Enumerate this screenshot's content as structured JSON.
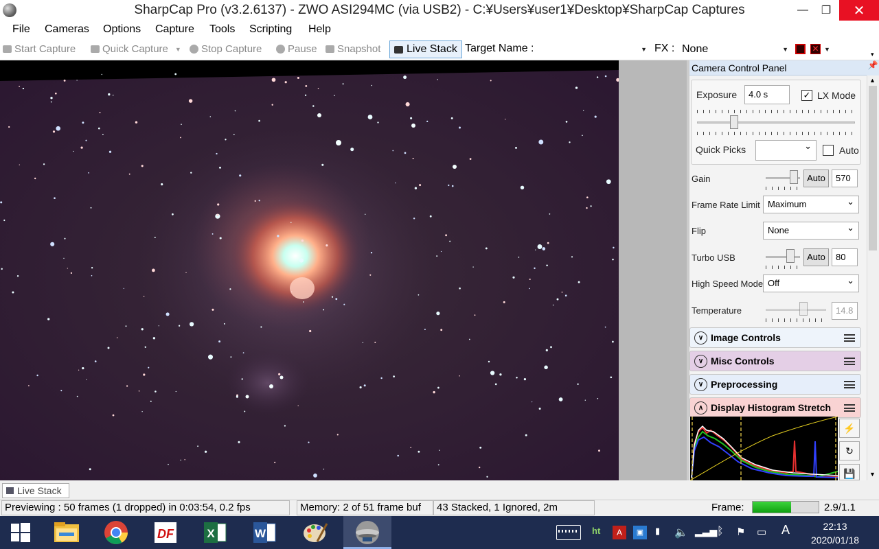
{
  "window": {
    "title": "SharpCap Pro (v3.2.6137) - ZWO ASI294MC (via USB2) - C:¥Users¥user1¥Desktop¥SharpCap Captures",
    "minimize": "—",
    "maximize": "❐",
    "close": "✕"
  },
  "menu": [
    "File",
    "Cameras",
    "Options",
    "Capture",
    "Tools",
    "Scripting",
    "Help"
  ],
  "toolbar": {
    "start_capture": "Start Capture",
    "quick_capture": "Quick Capture",
    "stop_capture": "Stop Capture",
    "pause": "Pause",
    "snapshot": "Snapshot",
    "live_stack": "Live Stack",
    "target_name_label": "Target Name :",
    "target_name_value": "",
    "fx_label": "FX :",
    "fx_value": "None"
  },
  "panel": {
    "title": "Camera Control Panel",
    "exposure_label": "Exposure",
    "exposure_value": "4.0 s",
    "lx_mode_label": "LX Mode",
    "lx_mode_checked": true,
    "exposure_slider_level": 0.22,
    "quick_picks_label": "Quick Picks",
    "quick_picks_value": "",
    "auto_label": "Auto",
    "auto_checked": false,
    "gain_label": "Gain",
    "gain_auto": "Auto",
    "gain_value": "570",
    "gain_slider_level": 0.93,
    "frame_rate_label": "Frame Rate Limit",
    "frame_rate_value": "Maximum",
    "flip_label": "Flip",
    "flip_value": "None",
    "turbo_label": "Turbo USB",
    "turbo_auto": "Auto",
    "turbo_value": "80",
    "turbo_slider_level": 0.8,
    "high_speed_label": "High Speed Mode",
    "high_speed_value": "Off",
    "temperature_label": "Temperature",
    "temperature_value": "14.8",
    "temperature_slider_level": 0.65
  },
  "sections": [
    {
      "label": "Image Controls",
      "color": "#eef4fb",
      "expanded": false
    },
    {
      "label": "Misc Controls",
      "color": "#e4cfe6",
      "expanded": false
    },
    {
      "label": "Preprocessing",
      "color": "#e6eefa",
      "expanded": false
    },
    {
      "label": "Display Histogram Stretch",
      "color": "#f9d3d3",
      "expanded": true
    }
  ],
  "tab": {
    "label": "Live Stack"
  },
  "status": {
    "previewing": "Previewing : 50 frames (1 dropped) in 0:03:54, 0.2 fps",
    "memory": "Memory: 2 of 51 frame buf",
    "stacked": "43 Stacked, 1 Ignored, 2m",
    "frame_label": "Frame:",
    "frame_progress": 0.58,
    "frame_ratio": "2.9/1.1"
  },
  "taskbar": {
    "time": "22:13",
    "date": "2020/01/18",
    "ime": "A",
    "apps": [
      "file-explorer-icon",
      "chrome-icon",
      "df-icon",
      "excel-icon",
      "word-icon",
      "paint-icon",
      "sharpcap-icon"
    ]
  },
  "colors": {
    "accent": "#0078d7",
    "close_red": "#e81123",
    "taskbar": "#1e2c4f"
  }
}
